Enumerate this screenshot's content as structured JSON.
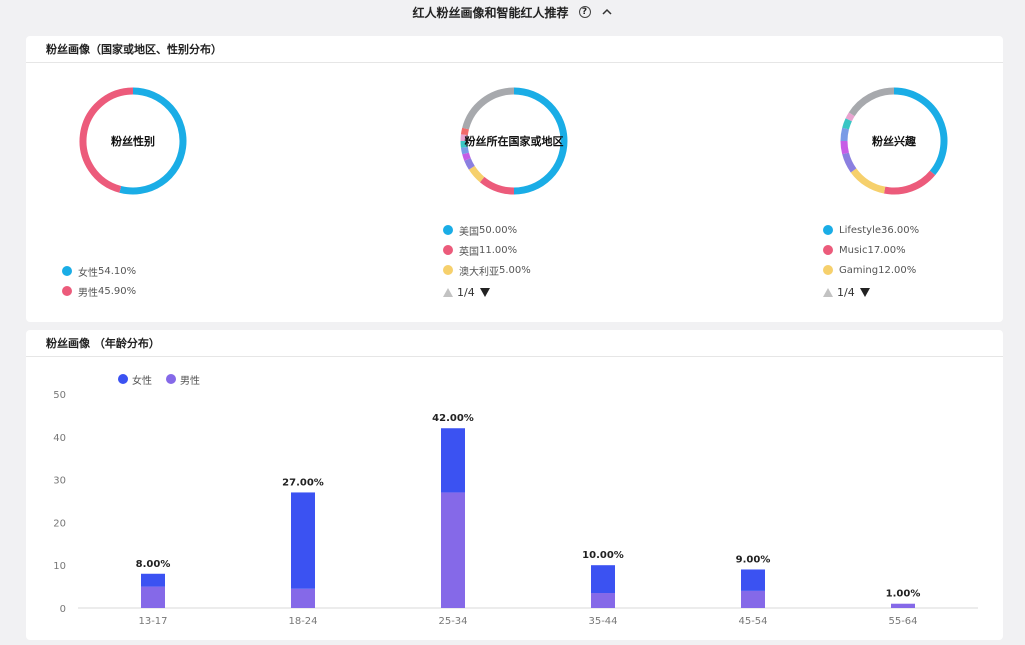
{
  "header": {
    "title": "红人粉丝画像和智能红人推荐",
    "help_icon": "question-circle-icon",
    "toggle_icon": "chevron-up-icon"
  },
  "profile_card": {
    "title": "粉丝画像（国家或地区、性别分布）",
    "gender": {
      "center_label": "粉丝性别",
      "items": [
        {
          "label": "女性",
          "value": "54.10%",
          "share": 54.1,
          "color": "#1aade6"
        },
        {
          "label": "男性",
          "value": "45.90%",
          "share": 45.9,
          "color": "#ec5b7b"
        }
      ]
    },
    "country": {
      "center_label": "粉丝所在国家或地区",
      "items": [
        {
          "label": "美国",
          "value": "50.00%",
          "share": 50,
          "color": "#1aade6"
        },
        {
          "label": "英国",
          "value": "11.00%",
          "share": 11,
          "color": "#ec5b7b"
        },
        {
          "label": "澳大利亚",
          "value": "5.00%",
          "share": 5,
          "color": "#f6d06c"
        }
      ],
      "other_segments": [
        {
          "share": 3,
          "color": "#8b7fe0"
        },
        {
          "share": 2,
          "color": "#c65de6"
        },
        {
          "share": 2,
          "color": "#7a9be6"
        },
        {
          "share": 2,
          "color": "#39c6c4"
        },
        {
          "share": 2,
          "color": "#e8a3d0"
        },
        {
          "share": 2,
          "color": "#f26a6a"
        },
        {
          "share": 21,
          "color": "#a7a9ad"
        }
      ],
      "pager": "1/4"
    },
    "interest": {
      "center_label": "粉丝兴趣",
      "items": [
        {
          "label": "Lifestyle",
          "value": "36.00%",
          "share": 36,
          "color": "#1aade6"
        },
        {
          "label": "Music",
          "value": "17.00%",
          "share": 17,
          "color": "#ec5b7b"
        },
        {
          "label": "Gaming",
          "value": "12.00%",
          "share": 12,
          "color": "#f6d06c"
        }
      ],
      "other_segments": [
        {
          "share": 6,
          "color": "#8b7fe0"
        },
        {
          "share": 4,
          "color": "#c65de6"
        },
        {
          "share": 4,
          "color": "#7a9be6"
        },
        {
          "share": 3,
          "color": "#39c6c4"
        },
        {
          "share": 2,
          "color": "#e8a3d0"
        },
        {
          "share": 16,
          "color": "#a7a9ad"
        }
      ],
      "pager": "1/4"
    }
  },
  "age_card": {
    "title": "粉丝画像 （年龄分布）"
  },
  "chart_data": {
    "type": "bar",
    "stacked": true,
    "categories": [
      "13-17",
      "18-24",
      "25-34",
      "35-44",
      "45-54",
      "55-64"
    ],
    "series": [
      {
        "name": "女性",
        "color": "#3b52f2",
        "values": [
          3,
          22.5,
          15,
          6.5,
          5,
          0
        ]
      },
      {
        "name": "男性",
        "color": "#8569e8",
        "values": [
          5,
          4.5,
          27,
          3.5,
          4,
          1
        ]
      }
    ],
    "totals": [
      "8.00%",
      "27.00%",
      "42.00%",
      "10.00%",
      "9.00%",
      "1.00%"
    ],
    "ylim": [
      0,
      50
    ],
    "yticks": [
      0,
      10,
      20,
      30,
      40,
      50
    ],
    "grid": false,
    "legend": "top-left"
  }
}
